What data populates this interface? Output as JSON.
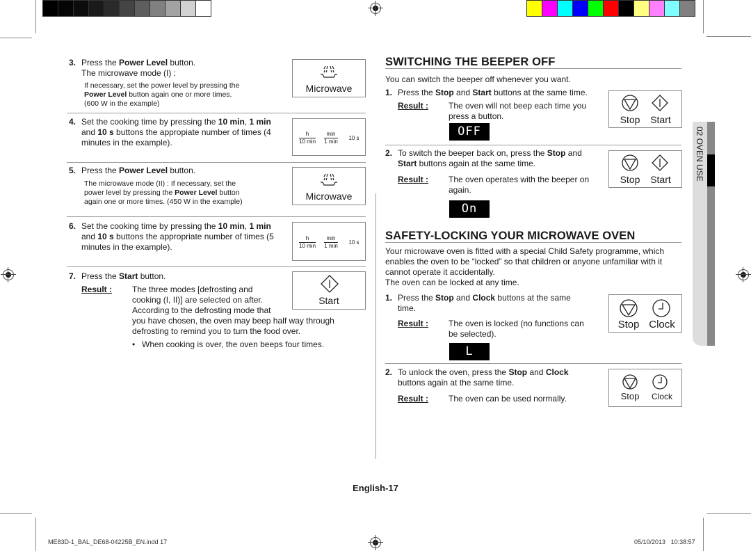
{
  "color_bars": {
    "grayscale": [
      "#000000",
      "#050505",
      "#0c0c0c",
      "#1a1a1a",
      "#2a2a2a",
      "#444444",
      "#5e5e5e",
      "#808080",
      "#a3a3a3",
      "#d2d2d2",
      "#ffffff"
    ],
    "colors": [
      "#ffff00",
      "#ff00ff",
      "#00ffff",
      "#0000ff",
      "#00ff00",
      "#ff0000",
      "#000000",
      "#ffff80",
      "#ff80ff",
      "#80ffff",
      "#808080"
    ]
  },
  "left": {
    "step3": {
      "num": "3.",
      "line1_pre": "Press the ",
      "line1_bold": "Power Level",
      "line1_post": " button.",
      "line2": "The microwave mode (I) :",
      "note_pre": "If necessary, set the power level by pressing the",
      "note_bold": "Power Level",
      "note_post": " button again one or more times.",
      "note_example": "(600 W in the example)",
      "icon_label": "Microwave"
    },
    "step4": {
      "num": "4.",
      "t1": "Set the cooking time by pressing the ",
      "b1": "10 min",
      "t2": ", ",
      "b2": "1 min",
      "t3": "and ",
      "b3": "10 s",
      "t4": " buttons the appropiate number of times (4",
      "t5": "minutes in the example).",
      "timer": {
        "h": "h",
        "ten_min": "10 min",
        "min": "min",
        "one_min": "1 min",
        "ten_s": "10 s"
      }
    },
    "step5": {
      "num": "5.",
      "line1_pre": "Press the ",
      "line1_bold": "Power Level",
      "line1_post": " button.",
      "note1": "The microwave mode (II) : If necessary, set the",
      "note2_pre": "power level by pressing the ",
      "note2_bold": "Power Level",
      "note2_post": " button",
      "note3": "again one or more times. (450 W in the example)",
      "icon_label": "Microwave"
    },
    "step6": {
      "num": "6.",
      "t1": "Set the cooking time by pressing the ",
      "b1": "10 min",
      "t2": ", ",
      "b2": "1 min",
      "t3": "and ",
      "b3": "10 s",
      "t4": " buttons the appropriate number of times (5",
      "t5": "minutes in the example).",
      "timer": {
        "h": "h",
        "ten_min": "10 min",
        "min": "min",
        "one_min": "1 min",
        "ten_s": "10 s"
      }
    },
    "step7": {
      "num": "7.",
      "line1_pre": "Press the ",
      "line1_bold": "Start",
      "line1_post": " button.",
      "result_label": "Result :",
      "r1": "The three modes [defrosting and",
      "r2": "cooking (I, II)] are selected on after.",
      "r3": "According to the defrosting mode that",
      "r4": "you have chosen, the oven may beep half way through",
      "r5": "defrosting to remind you to turn the food over.",
      "bullet": "When cooking is over, the oven beeps four times.",
      "icon_label": "Start"
    }
  },
  "right": {
    "beeper": {
      "heading": "SWITCHING THE BEEPER OFF",
      "intro": "You can switch the beeper off whenever you want.",
      "step1": {
        "num": "1.",
        "t1": "Press the ",
        "b1": "Stop",
        "t2": " and ",
        "b2": "Start",
        "t3": " buttons at the same time.",
        "result_label": "Result :",
        "r1": "The oven will not beep each time you",
        "r2": "press a button.",
        "display": "OFF",
        "stop_label": "Stop",
        "start_label": "Start"
      },
      "step2": {
        "num": "2.",
        "t1": "To switch the beeper back on, press the ",
        "b1": "Stop",
        "t2": " and",
        "b2": "Start",
        "t3": " buttons again at the same time.",
        "result_label": "Result :",
        "r1": "The oven operates with the beeper on",
        "r2": "again.",
        "display": "On",
        "stop_label": "Stop",
        "start_label": "Start"
      }
    },
    "lock": {
      "heading": "SAFETY-LOCKING YOUR MICROWAVE OVEN",
      "p1": "Your microwave oven is fitted with a special Child Safety programme, which",
      "p2": "enables the oven to be “locked” so that children or anyone unfamiliar with it",
      "p3": "cannot operate it accidentally.",
      "p4": "The oven can be locked at any time.",
      "step1": {
        "num": "1.",
        "t1": "Press the ",
        "b1": "Stop",
        "t2": " and ",
        "b2": "Clock",
        "t3": " buttons at the same",
        "t4": "time.",
        "result_label": "Result :",
        "r1": "The oven is locked (no functions can",
        "r2": "be selected).",
        "display": "L",
        "stop_label": "Stop",
        "clock_label": "Clock"
      },
      "step2": {
        "num": "2.",
        "t1": "To unlock the oven, press the ",
        "b1": "Stop",
        "t2": " and ",
        "b2": "Clock",
        "t3": "buttons again at the same time.",
        "result_label": "Result :",
        "r1": "The oven can be used normally.",
        "stop_label": "Stop",
        "clock_label": "Clock"
      }
    },
    "side_tab": "02  OVEN USE"
  },
  "footer": {
    "page": "English-17",
    "file": "ME83D-1_BAL_DE68-04225B_EN.indd   17",
    "date": "05/10/2013",
    "time": "10:38:57"
  }
}
